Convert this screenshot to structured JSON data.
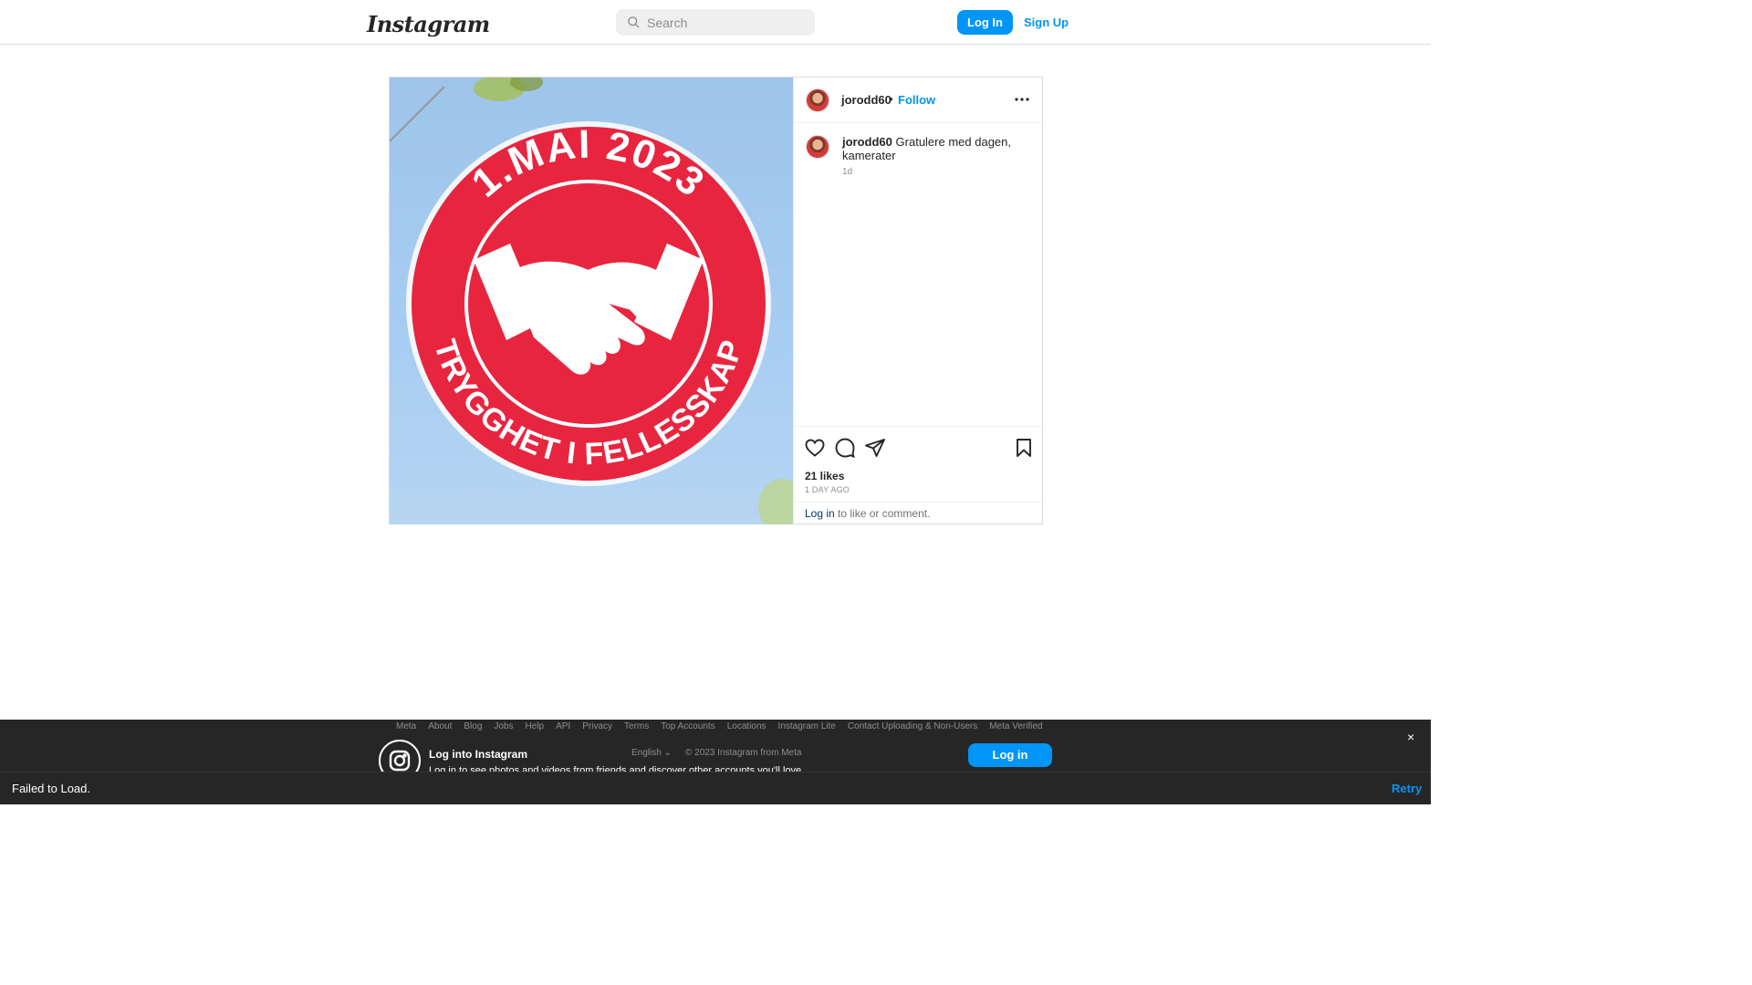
{
  "header": {
    "logo": "Instagram",
    "search_placeholder": "Search",
    "login_label": "Log In",
    "signup_label": "Sign Up"
  },
  "post": {
    "image": {
      "badge_top_text": "1.MAI 2023",
      "badge_bottom_text": "TRYGGHET I FELLESSKAP",
      "badge_color": "#e8253f"
    },
    "author": "jorodd60",
    "separator": "•",
    "follow_label": "Follow",
    "caption_user": "jorodd60",
    "caption_text": "Gratulere med dagen, kamerater",
    "caption_time": "1d",
    "likes": "21 likes",
    "time_ago": "1 DAY AGO",
    "login_link": "Log in",
    "login_suffix": " to like or comment."
  },
  "footer": {
    "links": [
      "Meta",
      "About",
      "Blog",
      "Jobs",
      "Help",
      "API",
      "Privacy",
      "Terms",
      "Top Accounts",
      "Locations",
      "Instagram Lite",
      "Contact Uploading & Non-Users",
      "Meta Verified"
    ],
    "language": "English",
    "copyright": "© 2023 Instagram from Meta"
  },
  "overlay": {
    "title": "Log into Instagram",
    "subtitle": "Log in to see photos and videos from friends and discover other accounts you'll love.",
    "login_label": "Log in",
    "close": "×"
  },
  "toast": {
    "message": "Failed to Load.",
    "retry": "Retry"
  },
  "icons": {
    "search": "search-icon",
    "more": "more-options-icon",
    "like": "heart-icon",
    "comment": "comment-icon",
    "share": "send-icon",
    "save": "bookmark-icon",
    "instagram": "instagram-icon"
  },
  "colors": {
    "accent": "#0095f6",
    "badge_red": "#e8253f"
  }
}
